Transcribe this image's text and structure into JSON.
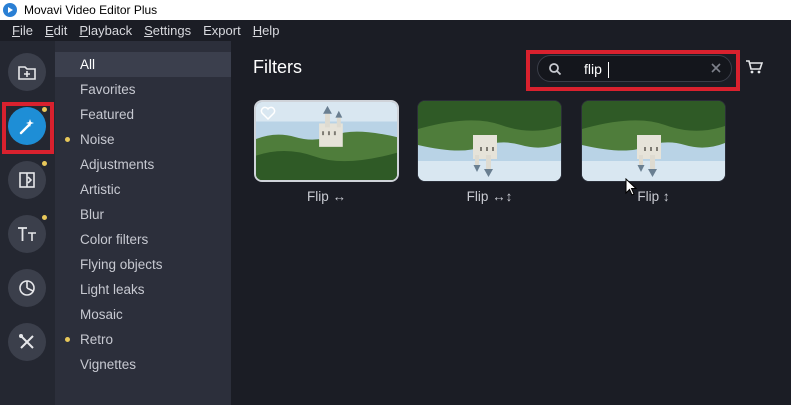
{
  "window": {
    "title": "Movavi Video Editor Plus"
  },
  "menu": [
    {
      "underline": "F",
      "rest": "ile"
    },
    {
      "underline": "E",
      "rest": "dit"
    },
    {
      "underline": "P",
      "rest": "layback"
    },
    {
      "underline": "S",
      "rest": "ettings"
    },
    {
      "underline": "",
      "rest": "Export"
    },
    {
      "underline": "H",
      "rest": "elp"
    }
  ],
  "toolbar": {
    "tools": [
      {
        "name": "import-icon",
        "active": false,
        "dot": false
      },
      {
        "name": "filters-magic-wand-icon",
        "active": true,
        "dot": true
      },
      {
        "name": "transitions-icon",
        "active": false,
        "dot": true
      },
      {
        "name": "titles-icon",
        "active": false,
        "dot": true
      },
      {
        "name": "stickers-icon",
        "active": false,
        "dot": false
      },
      {
        "name": "more-tools-icon",
        "active": false,
        "dot": false
      }
    ]
  },
  "categories": [
    {
      "label": "All",
      "selected": true,
      "dot": false
    },
    {
      "label": "Favorites",
      "selected": false,
      "dot": false
    },
    {
      "label": "Featured",
      "selected": false,
      "dot": false
    },
    {
      "label": "Noise",
      "selected": false,
      "dot": true
    },
    {
      "label": "Adjustments",
      "selected": false,
      "dot": false
    },
    {
      "label": "Artistic",
      "selected": false,
      "dot": false
    },
    {
      "label": "Blur",
      "selected": false,
      "dot": false
    },
    {
      "label": "Color filters",
      "selected": false,
      "dot": false
    },
    {
      "label": "Flying objects",
      "selected": false,
      "dot": false
    },
    {
      "label": "Light leaks",
      "selected": false,
      "dot": false
    },
    {
      "label": "Mosaic",
      "selected": false,
      "dot": false
    },
    {
      "label": "Retro",
      "selected": false,
      "dot": true
    },
    {
      "label": "Vignettes",
      "selected": false,
      "dot": false
    }
  ],
  "main": {
    "heading": "Filters",
    "search": {
      "value": "flip"
    },
    "filters": [
      {
        "label": "Flip ↔",
        "variant": "normal",
        "hovered": true
      },
      {
        "label": "Flip ↔↕",
        "variant": "mirrored",
        "hovered": false
      },
      {
        "label": "Flip ↕",
        "variant": "mirrored",
        "hovered": false
      }
    ]
  },
  "colors": {
    "accent": "#1e8ed6",
    "highlight": "#d9212e",
    "new_dot": "#e8c85a"
  }
}
